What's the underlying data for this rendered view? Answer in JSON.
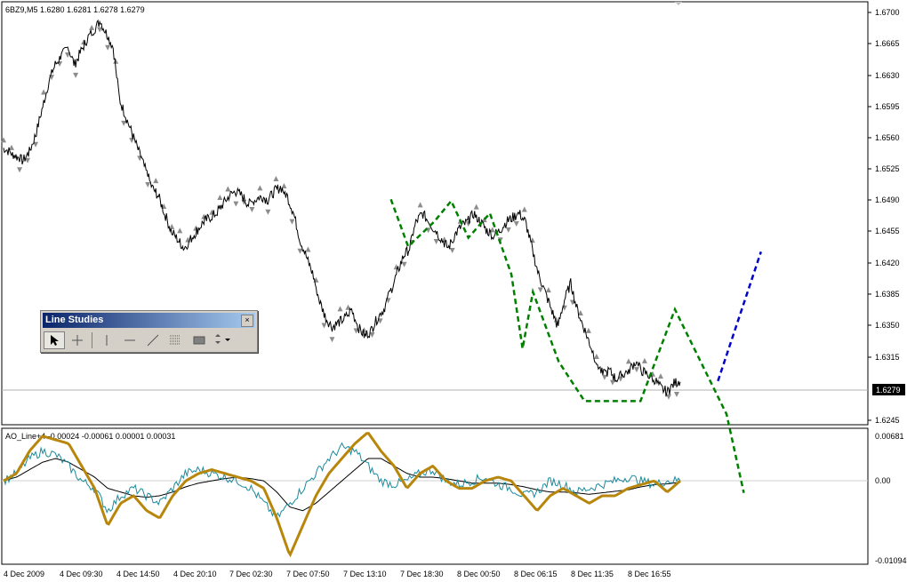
{
  "window": {
    "title": "6BZ9,M5  1.6280 1.6281 1.6278 1.6279"
  },
  "price_axis": {
    "labels": [
      "1.6700",
      "1.6665",
      "1.6630",
      "1.6595",
      "1.6560",
      "1.6525",
      "1.6490",
      "1.6455",
      "1.6420",
      "1.6385",
      "1.6350",
      "1.6315",
      "1.6245"
    ],
    "current_price": "1.6279"
  },
  "indicator": {
    "title": "AO_Line+4 -0.00024 -0.00061 0.00001 0.00031",
    "axis_labels": [
      "0.00681",
      "0.00",
      "-0.01094"
    ]
  },
  "time_axis": {
    "labels": [
      "4 Dec 2009",
      "4 Dec 09:30",
      "4 Dec 14:50",
      "4 Dec 20:10",
      "7 Dec 02:30",
      "7 Dec 07:50",
      "7 Dec 13:10",
      "7 Dec 18:30",
      "8 Dec 00:50",
      "8 Dec 06:15",
      "8 Dec 11:35",
      "8 Dec 16:55"
    ]
  },
  "toolbar": {
    "title": "Line Studies",
    "close_label": "×",
    "tools": [
      "cursor-icon",
      "crosshair-icon",
      "vertical-line-icon",
      "horizontal-line-icon",
      "trendline-icon",
      "fibonacci-icon",
      "rectangle-icon",
      "arrows-icon"
    ]
  },
  "chart_data": {
    "type": "line",
    "price_chart": {
      "ylim": [
        1.623,
        1.671
      ],
      "close": [
        1.6545,
        1.654,
        1.6535,
        1.653,
        1.654,
        1.656,
        1.659,
        1.662,
        1.664,
        1.665,
        1.666,
        1.664,
        1.6655,
        1.667,
        1.668,
        1.669,
        1.6675,
        1.666,
        1.66,
        1.658,
        1.656,
        1.654,
        1.652,
        1.65,
        1.649,
        1.647,
        1.645,
        1.644,
        1.643,
        1.644,
        1.645,
        1.646,
        1.6465,
        1.647,
        1.648,
        1.649,
        1.6495,
        1.649,
        1.648,
        1.6485,
        1.649,
        1.6485,
        1.6495,
        1.65,
        1.649,
        1.647,
        1.644,
        1.642,
        1.64,
        1.637,
        1.635,
        1.634,
        1.6345,
        1.635,
        1.636,
        1.634,
        1.633,
        1.6335,
        1.635,
        1.636,
        1.638,
        1.64,
        1.642,
        1.643,
        1.646,
        1.647,
        1.646,
        1.645,
        1.644,
        1.643,
        1.6445,
        1.6455,
        1.646,
        1.647,
        1.646,
        1.645,
        1.6445,
        1.645,
        1.646,
        1.6465,
        1.647,
        1.646,
        1.643,
        1.64,
        1.638,
        1.636,
        1.634,
        1.637,
        1.639,
        1.636,
        1.634,
        1.632,
        1.63,
        1.6285,
        1.629,
        1.628,
        1.6285,
        1.629,
        1.63,
        1.629,
        1.6285,
        1.628,
        1.627,
        1.6265,
        1.6275,
        1.6279
      ],
      "zigzag_green": [
        [
          0.45,
          1.6486
        ],
        [
          0.47,
          1.6432
        ],
        [
          0.5,
          1.646
        ],
        [
          0.52,
          1.6484
        ],
        [
          0.54,
          1.6442
        ],
        [
          0.565,
          1.647
        ],
        [
          0.59,
          1.64
        ],
        [
          0.603,
          1.6315
        ],
        [
          0.615,
          1.638
        ],
        [
          0.645,
          1.63
        ],
        [
          0.675,
          1.6255
        ],
        [
          0.74,
          1.6255
        ],
        [
          0.78,
          1.636
        ],
        [
          0.84,
          1.624
        ],
        [
          0.86,
          1.615
        ]
      ],
      "zigzag_blue": [
        [
          0.83,
          1.6278
        ],
        [
          0.88,
          1.6426
        ]
      ]
    },
    "indicator_chart": {
      "ylim": [
        -0.01094,
        0.00681
      ],
      "ao_thick": [
        0.0,
        0.001,
        0.004,
        0.006,
        0.0055,
        0.005,
        0.002,
        -0.001,
        -0.006,
        -0.003,
        -0.002,
        -0.004,
        -0.005,
        -0.002,
        0.0,
        0.001,
        0.0015,
        0.001,
        0.0005,
        0.0,
        -0.001,
        -0.005,
        -0.01,
        -0.006,
        -0.002,
        0.001,
        0.003,
        0.005,
        0.0065,
        0.004,
        0.002,
        -0.001,
        0.001,
        0.002,
        0.0,
        -0.001,
        -0.001,
        0.0,
        0.0005,
        0.0,
        -0.002,
        -0.004,
        -0.002,
        -0.001,
        -0.002,
        -0.003,
        -0.002,
        -0.002,
        -0.001,
        -0.0005,
        0.0,
        -0.0015,
        0.0
      ],
      "signal_teal": [
        0.0,
        0.001,
        0.003,
        0.004,
        0.0035,
        0.002,
        0.0,
        -0.001,
        -0.004,
        -0.002,
        -0.001,
        -0.002,
        -0.003,
        -0.001,
        0.001,
        0.0015,
        0.001,
        0.0005,
        0.0,
        -0.001,
        -0.003,
        -0.005,
        -0.003,
        -0.001,
        0.001,
        0.003,
        0.0045,
        0.004,
        0.002,
        0.0,
        -0.0005,
        0.0,
        0.001,
        0.0015,
        0.0,
        -0.0005,
        0.0,
        0.0005,
        -0.0005,
        -0.001,
        -0.002,
        -0.0015,
        0.0,
        -0.0005,
        -0.0015,
        -0.001,
        -0.0005,
        0.0,
        0.0005,
        0.0,
        -0.0005,
        0.0,
        0.0001
      ],
      "ma_black": [
        0.0,
        0.0005,
        0.0015,
        0.0025,
        0.003,
        0.0025,
        0.0015,
        0.0005,
        -0.001,
        -0.0015,
        -0.002,
        -0.0022,
        -0.002,
        -0.0015,
        -0.0008,
        -0.0003,
        0.0,
        0.0003,
        0.0005,
        0.0003,
        0.0,
        -0.0015,
        -0.0035,
        -0.004,
        -0.003,
        -0.0015,
        0.0,
        0.0015,
        0.003,
        0.003,
        0.002,
        0.001,
        0.0005,
        0.0005,
        0.0003,
        0.0,
        -0.0003,
        -0.0003,
        -0.0003,
        -0.0005,
        -0.0008,
        -0.0012,
        -0.0015,
        -0.0015,
        -0.0016,
        -0.0018,
        -0.0016,
        -0.0014,
        -0.0012,
        -0.0008,
        -0.0005,
        -0.0004,
        -0.0002
      ]
    }
  }
}
